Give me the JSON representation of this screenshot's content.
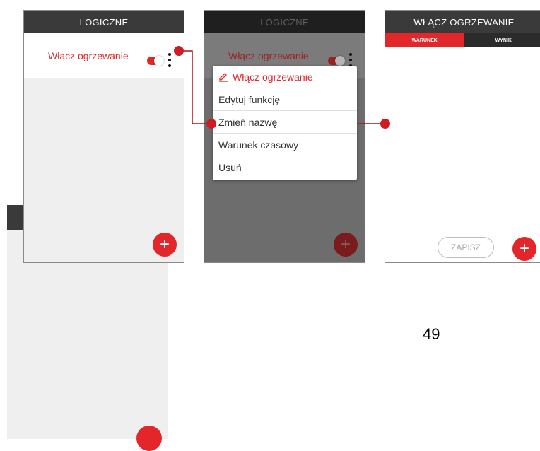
{
  "screen1": {
    "title": "LOGICZNE",
    "item_label": "Włącz ogrzewanie",
    "fab_label": "+"
  },
  "screen2": {
    "title": "LOGICZNE",
    "item_label": "Włącz ogrzewanie",
    "fab_label": "+",
    "menu": {
      "header_label": "Włącz ogrzewanie",
      "items": [
        "Edytuj funkcję",
        "Zmień nazwę",
        "Warunek czasowy",
        "Usuń"
      ]
    }
  },
  "screen3": {
    "title": "WŁĄCZ OGRZEWANIE",
    "tabs": [
      "WARUNEK",
      "WYNIK"
    ],
    "save_label": "ZAPISZ",
    "fab_label": "+"
  },
  "page_number": "49",
  "colors": {
    "accent": "#e2262a",
    "header": "#3a3a3a",
    "connector": "#b01015"
  },
  "icons": {
    "toggle": "toggle-icon",
    "kebab": "kebab-menu-icon",
    "add": "plus-icon",
    "edit": "pencil-icon"
  }
}
